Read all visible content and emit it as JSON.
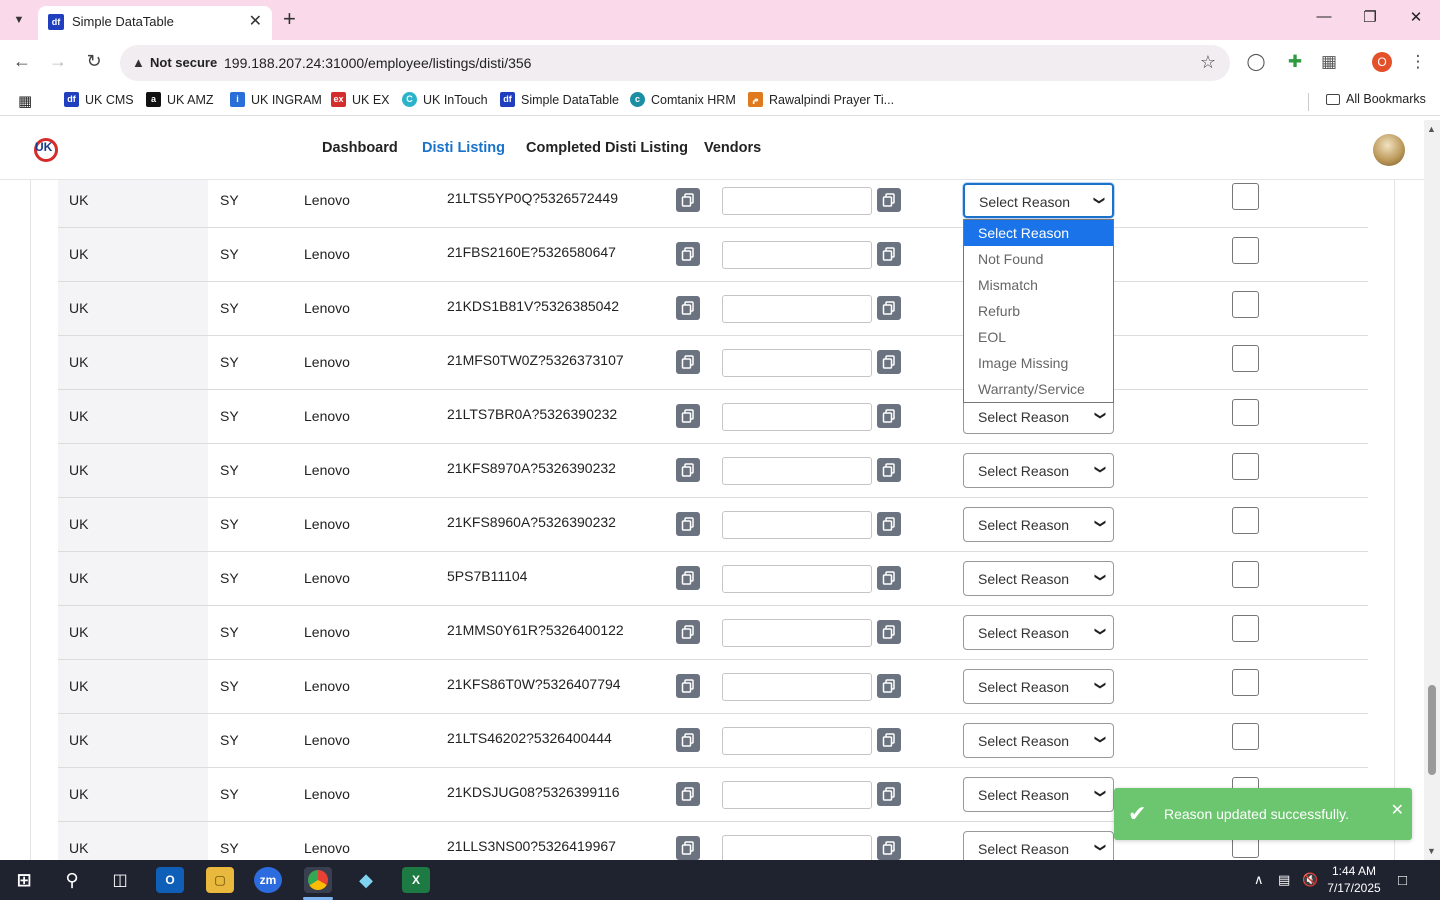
{
  "browser": {
    "tab_title": "Simple DataTable",
    "security_label": "Not secure",
    "url": "199.188.207.24:31000/employee/listings/disti/356",
    "profile_initial": "O",
    "bookmarks": [
      "UK CMS",
      "UK AMZ",
      "UK INGRAM",
      "UK EX",
      "UK InTouch",
      "Simple DataTable",
      "Comtanix HRM",
      "Rawalpindi Prayer Ti..."
    ],
    "all_bookmarks": "All Bookmarks"
  },
  "nav": {
    "logo": "UK",
    "links": [
      "Dashboard",
      "Disti Listing",
      "Completed Disti Listing",
      "Vendors"
    ],
    "active": "Disti Listing"
  },
  "select_placeholder": "Select Reason",
  "rows": [
    {
      "country": "UK",
      "code": "SY",
      "vendor": "Lenovo",
      "sku": "21LTS5YP0Q?5326572449"
    },
    {
      "country": "UK",
      "code": "SY",
      "vendor": "Lenovo",
      "sku": "21FBS2160E?5326580647"
    },
    {
      "country": "UK",
      "code": "SY",
      "vendor": "Lenovo",
      "sku": "21KDS1B81V?5326385042"
    },
    {
      "country": "UK",
      "code": "SY",
      "vendor": "Lenovo",
      "sku": "21MFS0TW0Z?5326373107"
    },
    {
      "country": "UK",
      "code": "SY",
      "vendor": "Lenovo",
      "sku": "21LTS7BR0A?5326390232"
    },
    {
      "country": "UK",
      "code": "SY",
      "vendor": "Lenovo",
      "sku": "21KFS8970A?5326390232"
    },
    {
      "country": "UK",
      "code": "SY",
      "vendor": "Lenovo",
      "sku": "21KFS8960A?5326390232"
    },
    {
      "country": "UK",
      "code": "SY",
      "vendor": "Lenovo",
      "sku": "5PS7B11104"
    },
    {
      "country": "UK",
      "code": "SY",
      "vendor": "Lenovo",
      "sku": "21MMS0Y61R?5326400122"
    },
    {
      "country": "UK",
      "code": "SY",
      "vendor": "Lenovo",
      "sku": "21KFS86T0W?5326407794"
    },
    {
      "country": "UK",
      "code": "SY",
      "vendor": "Lenovo",
      "sku": "21LTS46202?5326400444"
    },
    {
      "country": "UK",
      "code": "SY",
      "vendor": "Lenovo",
      "sku": "21KDSJUG08?5326399116"
    },
    {
      "country": "UK",
      "code": "SY",
      "vendor": "Lenovo",
      "sku": "21LLS3NS00?5326419967"
    }
  ],
  "dropdown": {
    "options": [
      "Select Reason",
      "Not Found",
      "Mismatch",
      "Refurb",
      "EOL",
      "Image Missing",
      "Warranty/Service"
    ],
    "highlighted": "Select Reason"
  },
  "toast": {
    "message": "Reason updated successfully.",
    "color": "#6cc56f"
  },
  "taskbar": {
    "time": "1:44 AM",
    "date": "7/17/2025"
  },
  "colors": {
    "accent": "#1a73c9",
    "titlebar": "#f9d9ea"
  }
}
